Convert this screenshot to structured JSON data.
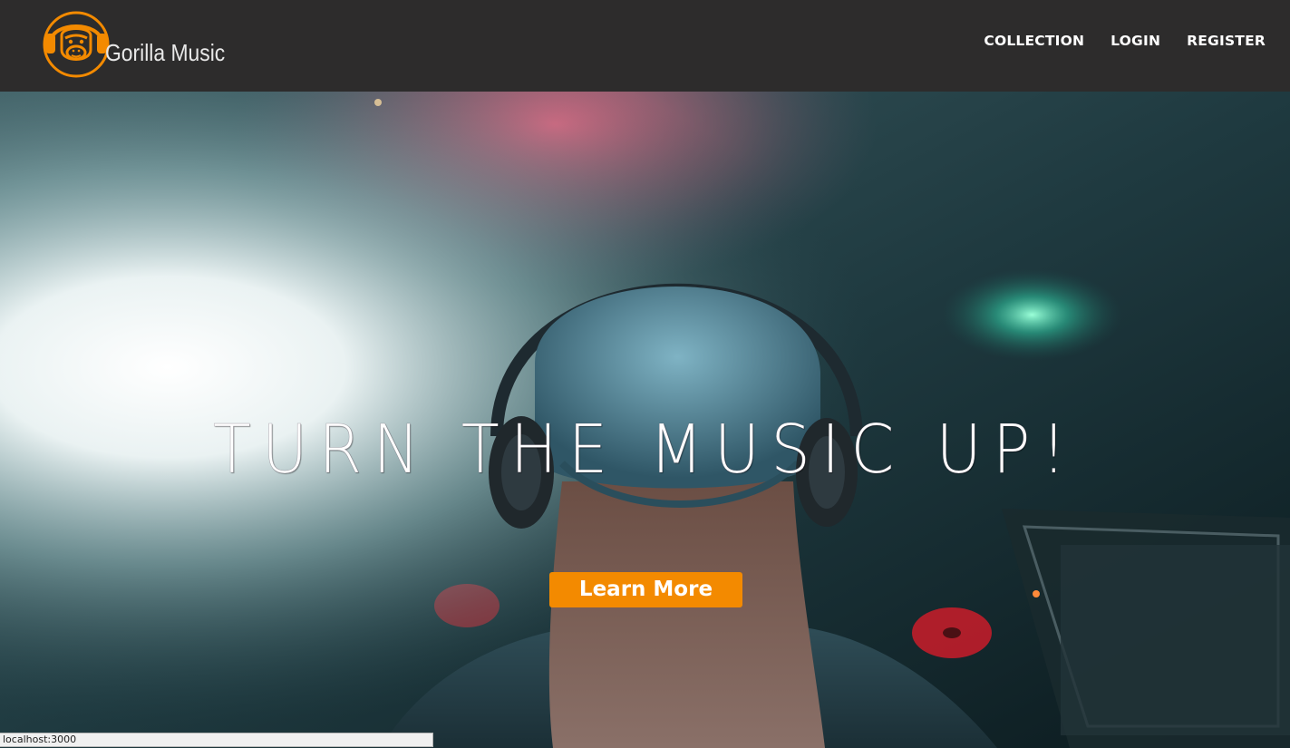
{
  "brand": {
    "name": "Gorilla Music",
    "logo_icon": "gorilla-headphones-icon",
    "accent_color": "#f38a00"
  },
  "nav": {
    "items": [
      {
        "label": "COLLECTION"
      },
      {
        "label": "LOGIN"
      },
      {
        "label": "REGISTER"
      }
    ]
  },
  "hero": {
    "title": "TURN THE MUSIC UP!",
    "cta_label": "Learn More",
    "background": "dj-with-headphones-photo"
  },
  "status_bar": {
    "url": "localhost:3000"
  },
  "colors": {
    "navbar_bg": "#2d2c2c",
    "cta_bg": "#f38a00",
    "text": "#ffffff"
  }
}
